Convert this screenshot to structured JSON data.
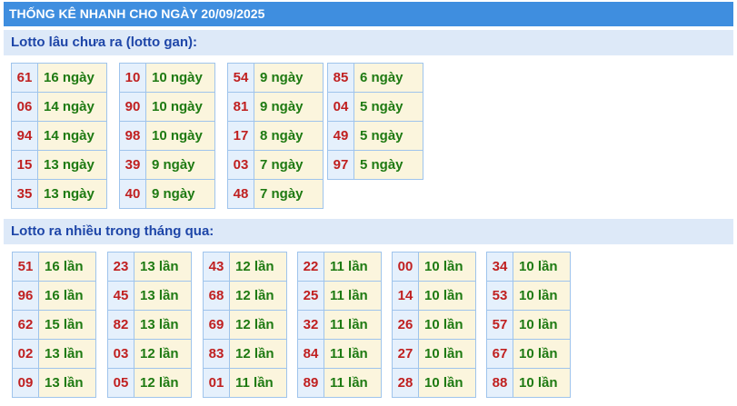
{
  "header": {
    "title": "THỐNG KÊ NHANH CHO NGÀY 20/09/2025"
  },
  "gan_section": {
    "title": "Lotto lâu chưa ra (lotto gan):",
    "groups": [
      [
        {
          "num": "61",
          "val": "16 ngày"
        },
        {
          "num": "06",
          "val": "14 ngày"
        },
        {
          "num": "94",
          "val": "14 ngày"
        },
        {
          "num": "15",
          "val": "13 ngày"
        },
        {
          "num": "35",
          "val": "13 ngày"
        }
      ],
      [
        {
          "num": "10",
          "val": "10 ngày"
        },
        {
          "num": "90",
          "val": "10 ngày"
        },
        {
          "num": "98",
          "val": "10 ngày"
        },
        {
          "num": "39",
          "val": "9 ngày"
        },
        {
          "num": "40",
          "val": "9 ngày"
        }
      ],
      [
        {
          "num": "54",
          "val": "9 ngày"
        },
        {
          "num": "81",
          "val": "9 ngày"
        },
        {
          "num": "17",
          "val": "8 ngày"
        },
        {
          "num": "03",
          "val": "7 ngày"
        },
        {
          "num": "48",
          "val": "7 ngày"
        }
      ],
      [
        {
          "num": "85",
          "val": "6 ngày"
        },
        {
          "num": "04",
          "val": "5 ngày"
        },
        {
          "num": "49",
          "val": "5 ngày"
        },
        {
          "num": "97",
          "val": "5 ngày"
        }
      ]
    ]
  },
  "freq_section": {
    "title": "Lotto ra nhiều trong tháng qua:",
    "groups": [
      [
        {
          "num": "51",
          "val": "16 lần"
        },
        {
          "num": "96",
          "val": "16 lần"
        },
        {
          "num": "62",
          "val": "15 lần"
        },
        {
          "num": "02",
          "val": "13 lần"
        },
        {
          "num": "09",
          "val": "13 lần"
        }
      ],
      [
        {
          "num": "23",
          "val": "13 lần"
        },
        {
          "num": "45",
          "val": "13 lần"
        },
        {
          "num": "82",
          "val": "13 lần"
        },
        {
          "num": "03",
          "val": "12 lần"
        },
        {
          "num": "05",
          "val": "12 lần"
        }
      ],
      [
        {
          "num": "43",
          "val": "12 lần"
        },
        {
          "num": "68",
          "val": "12 lần"
        },
        {
          "num": "69",
          "val": "12 lần"
        },
        {
          "num": "83",
          "val": "12 lần"
        },
        {
          "num": "01",
          "val": "11 lần"
        }
      ],
      [
        {
          "num": "22",
          "val": "11 lần"
        },
        {
          "num": "25",
          "val": "11 lần"
        },
        {
          "num": "32",
          "val": "11 lần"
        },
        {
          "num": "84",
          "val": "11 lần"
        },
        {
          "num": "89",
          "val": "11 lần"
        }
      ],
      [
        {
          "num": "00",
          "val": "10 lần"
        },
        {
          "num": "14",
          "val": "10 lần"
        },
        {
          "num": "26",
          "val": "10 lần"
        },
        {
          "num": "27",
          "val": "10 lần"
        },
        {
          "num": "28",
          "val": "10 lần"
        }
      ],
      [
        {
          "num": "34",
          "val": "10 lần"
        },
        {
          "num": "53",
          "val": "10 lần"
        },
        {
          "num": "57",
          "val": "10 lần"
        },
        {
          "num": "67",
          "val": "10 lần"
        },
        {
          "num": "88",
          "val": "10 lần"
        }
      ]
    ]
  }
}
